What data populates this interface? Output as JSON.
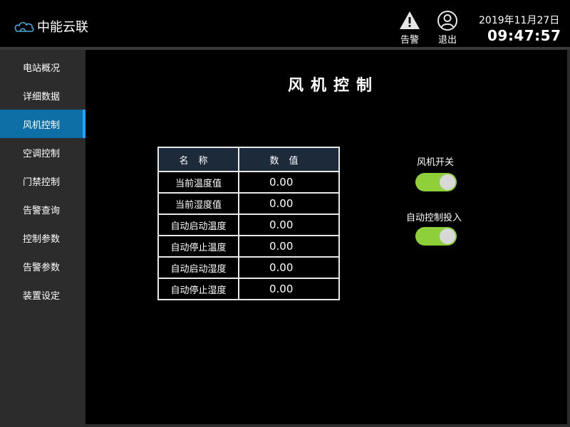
{
  "header": {
    "logo_text": "中能云联",
    "alarm_label": "告警",
    "logout_label": "退出",
    "date": "2019年11月27日",
    "time": "09:47:57"
  },
  "sidebar": {
    "items": [
      {
        "label": "电站概况",
        "active": false
      },
      {
        "label": "详细数据",
        "active": false
      },
      {
        "label": "风机控制",
        "active": true
      },
      {
        "label": "空调控制",
        "active": false
      },
      {
        "label": "门禁控制",
        "active": false
      },
      {
        "label": "告警查询",
        "active": false
      },
      {
        "label": "控制参数",
        "active": false
      },
      {
        "label": "告警参数",
        "active": false
      },
      {
        "label": "装置设定",
        "active": false
      }
    ]
  },
  "main": {
    "title": "风机控制",
    "table": {
      "headers": [
        "名称",
        "数值"
      ],
      "rows": [
        {
          "name": "当前温度值",
          "value": "0.00"
        },
        {
          "name": "当前湿度值",
          "value": "0.00"
        },
        {
          "name": "自动启动温度",
          "value": "0.00"
        },
        {
          "name": "自动停止温度",
          "value": "0.00"
        },
        {
          "name": "自动启动湿度",
          "value": "0.00"
        },
        {
          "name": "自动停止湿度",
          "value": "0.00"
        }
      ]
    },
    "switches": {
      "fan": {
        "label": "风机开关",
        "on": true
      },
      "auto": {
        "label": "自动控制投入",
        "on": true
      }
    }
  },
  "colors": {
    "active_nav": "#0e6ea6",
    "toggle_on": "#8fd03a",
    "table_header": "#1c2a3a",
    "sidebar_bg": "#2c2c2c"
  }
}
